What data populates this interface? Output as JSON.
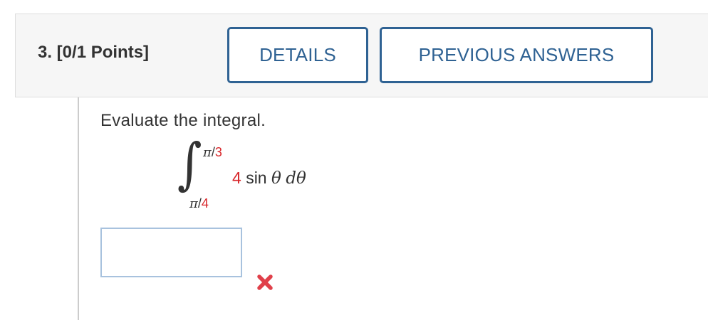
{
  "question": {
    "label": "3.  [0/1 Points]"
  },
  "header": {
    "details_label": "DETAILS",
    "previous_answers_label": "PREVIOUS ANSWERS"
  },
  "problem": {
    "prompt": "Evaluate the integral.",
    "integral": {
      "upper_limit_symbol": "π",
      "upper_limit_denominator": "3",
      "lower_limit_symbol": "π",
      "lower_limit_denominator": "4",
      "coefficient": "4",
      "function": "sin",
      "variable": "θ",
      "differential": "d",
      "differential_variable": "θ"
    }
  },
  "answer": {
    "value": "",
    "status": "incorrect",
    "status_icon": "x-mark-icon"
  },
  "colors": {
    "button_border": "#2f6293",
    "value_red": "#d8262a",
    "incorrect_red": "#e0404a",
    "input_border": "#a8c2de"
  }
}
